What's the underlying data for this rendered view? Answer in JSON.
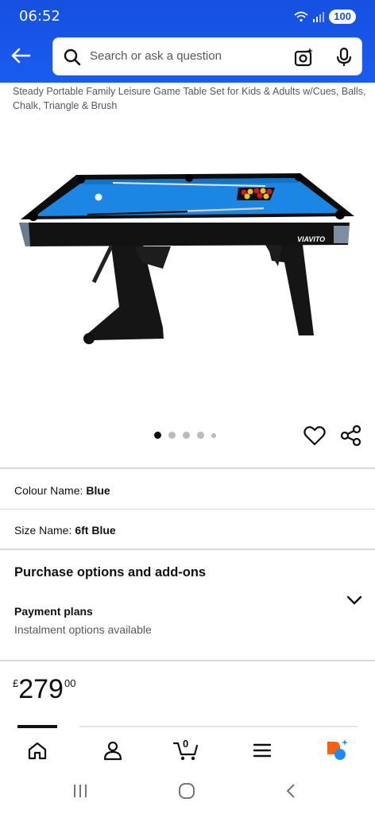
{
  "status_bar": {
    "time": "06:52",
    "battery": "100"
  },
  "search": {
    "placeholder": "Search or ask a question"
  },
  "product": {
    "title": "Steady Portable Family Leisure Game Table Set for Kids & Adults w/Cues, Balls, Chalk, Triangle & Brush",
    "image_brand_text": "VIAVITO",
    "image_count": 5,
    "active_image_index": 0
  },
  "colour": {
    "label": "Colour Name:",
    "value": "Blue"
  },
  "size": {
    "label": "Size Name:",
    "value": "6ft Blue"
  },
  "purchase_options": {
    "heading": "Purchase options and add-ons",
    "payment_title": "Payment plans",
    "payment_subtitle": "Instalment options available"
  },
  "price": {
    "currency": "£",
    "whole": "279",
    "fraction": "00"
  },
  "bottom_nav": {
    "cart_count": "0"
  },
  "colors": {
    "header_blue": "#1a5cf0",
    "alexa_orange": "#f7630c",
    "alexa_blue": "#1a8cff"
  }
}
